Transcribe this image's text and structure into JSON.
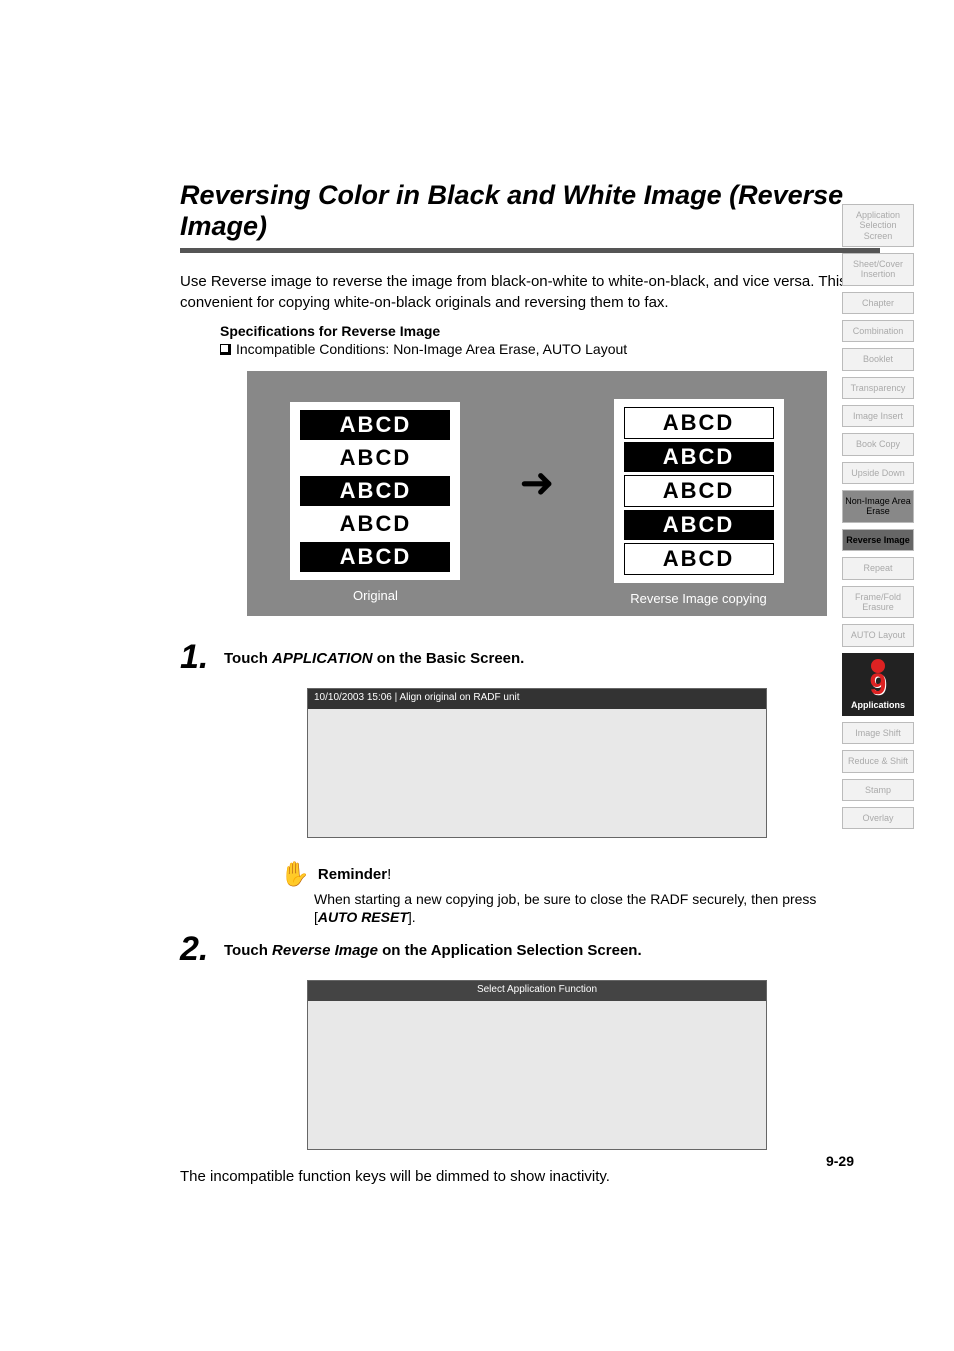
{
  "title": "Reversing Color in Black and White Image (Reverse Image)",
  "intro": "Use Reverse image to reverse the image from black-on-white to white-on-black, and vice versa. This is convenient for copying white-on-black originals and reversing them to fax.",
  "spec": {
    "heading": "Specifications for Reverse Image",
    "line": "Incompatible Conditions: Non-Image Area Erase, AUTO Layout"
  },
  "figure": {
    "sample_text": "ABCD",
    "caption_left": "Original",
    "caption_right": "Reverse Image copying"
  },
  "steps": {
    "s1": {
      "num": "1.",
      "prefix": "Touch ",
      "action": "APPLICATION",
      "suffix": " on the Basic Screen."
    },
    "s2": {
      "num": "2.",
      "prefix": "Touch ",
      "action": "Reverse Image",
      "suffix": " on the Application Selection Screen."
    }
  },
  "screenshot1": {
    "top_bar": "10/10/2003 15:06 | Align original on RADF unit"
  },
  "screenshot2": {
    "top_bar": "Select Application Function"
  },
  "reminder": {
    "title": "Reminder",
    "excl": "!",
    "body_prefix": "When starting a new copying job, be sure to close the RADF securely, then press [",
    "auto_reset": "AUTO RESET",
    "body_suffix": "]."
  },
  "footnote": "The incompatible function keys will be dimmed to show inactivity.",
  "page_number": "9-29",
  "tabs": [
    "Application Selection Screen",
    "Sheet/Cover Insertion",
    "Chapter",
    "Combination",
    "Booklet",
    "Transparency",
    "Image Insert",
    "Book Copy",
    "Upside Down",
    "Non-Image Area Erase",
    "Reverse Image",
    "Repeat",
    "Frame/Fold Erasure",
    "AUTO Layout"
  ],
  "apps_tab": {
    "nine": "9",
    "label": "Applications"
  },
  "tabs_after": [
    "Image Shift",
    "Reduce & Shift",
    "Stamp",
    "Overlay"
  ]
}
